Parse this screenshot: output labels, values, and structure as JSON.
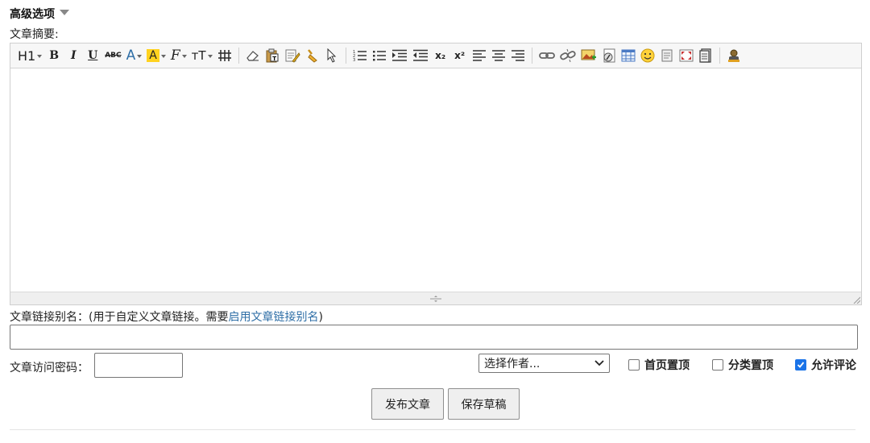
{
  "advanced": {
    "title": "高级选项"
  },
  "summary": {
    "label": "文章摘要:"
  },
  "toolbar": {
    "heading_label": "H1",
    "bold_label": "B",
    "italic_label": "I",
    "underline_label": "U",
    "strike_label": "ABC",
    "font_color_label": "A",
    "bg_color_label": "A",
    "font_family_label": "F",
    "font_size_label": "тT",
    "subscript_label": "x₂",
    "superscript_label": "x²"
  },
  "slug": {
    "label_prefix": "文章链接别名：(用于自定义文章链接。需要",
    "link_text": "启用文章链接别名",
    "label_suffix": ")",
    "value": ""
  },
  "password": {
    "label": "文章访问密码：",
    "value": ""
  },
  "author_select": {
    "selected": "选择作者..."
  },
  "checkboxes": {
    "home_top": {
      "label": "首页置顶",
      "checked": false
    },
    "category_top": {
      "label": "分类置顶",
      "checked": false
    },
    "allow_comment": {
      "label": "允许评论",
      "checked": true
    }
  },
  "buttons": {
    "publish": "发布文章",
    "save_draft": "保存草稿"
  },
  "colors": {
    "link": "#2e6ea6",
    "checkbox_checked": "#1a73e8",
    "highlight": "#ffd21f"
  }
}
